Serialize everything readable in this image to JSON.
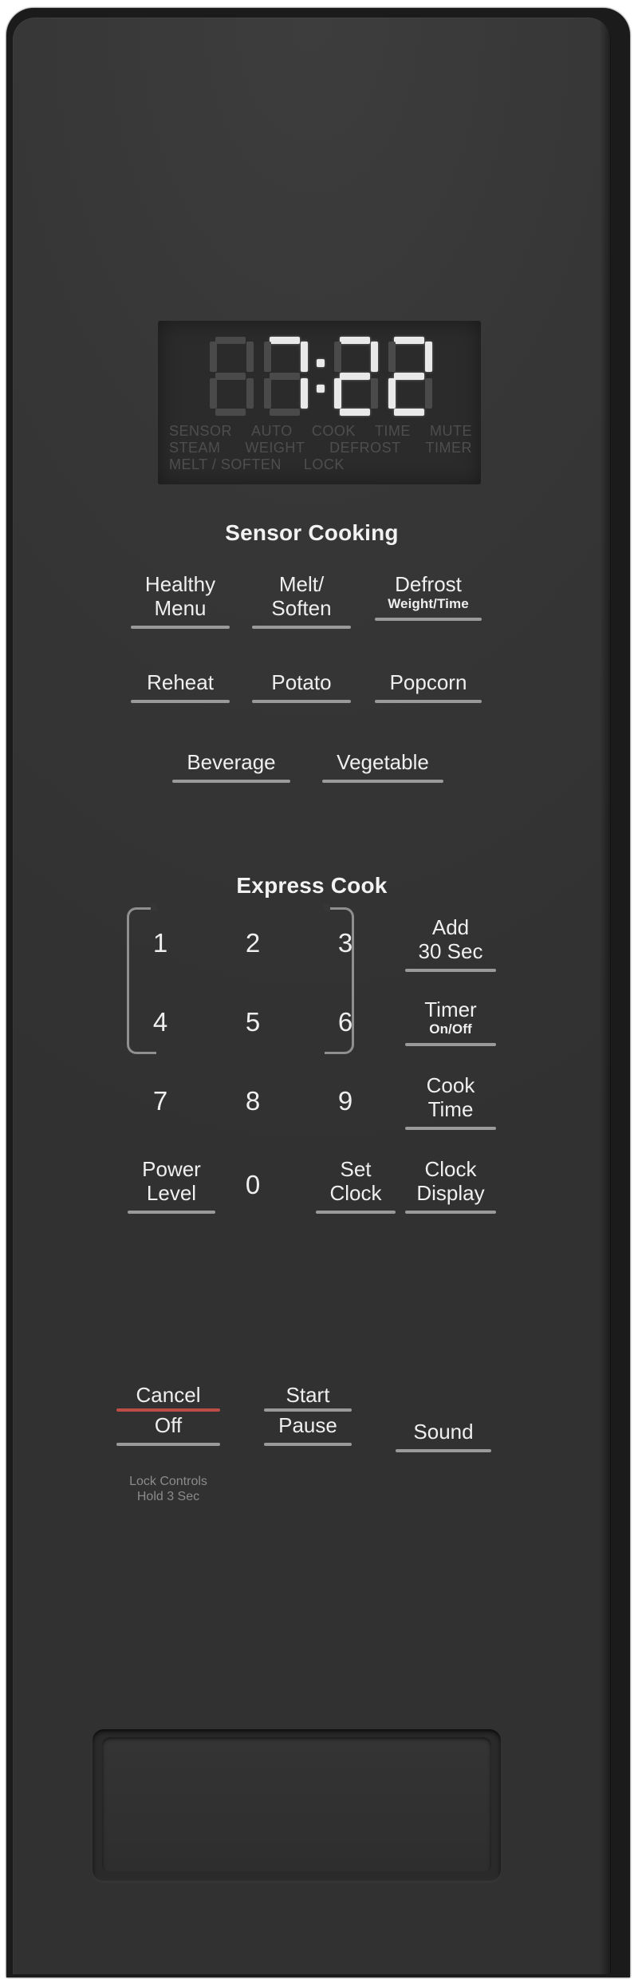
{
  "display": {
    "time": "7:22",
    "digits": [
      " ",
      "7",
      "2",
      "2"
    ],
    "colon_on": true,
    "indicator_rows": [
      [
        "SENSOR",
        "AUTO",
        "COOK",
        "TIME",
        "MUTE"
      ],
      [
        "STEAM",
        "WEIGHT",
        "DEFROST",
        "TIMER"
      ],
      [
        "MELT / SOFTEN",
        "LOCK"
      ]
    ]
  },
  "sensor_cooking": {
    "title": "Sensor Cooking",
    "row1": [
      {
        "line1": "Healthy",
        "line2": "Menu"
      },
      {
        "line1": "Melt/",
        "line2": "Soften"
      },
      {
        "line1": "Defrost",
        "line2": "Weight/Time"
      }
    ],
    "row2": [
      {
        "line1": "Reheat"
      },
      {
        "line1": "Potato"
      },
      {
        "line1": "Popcorn"
      }
    ],
    "row3": [
      {
        "line1": "Beverage"
      },
      {
        "line1": "Vegetable"
      }
    ]
  },
  "express_cook": {
    "title": "Express Cook",
    "keys": {
      "k1": "1",
      "k2": "2",
      "k3": "3",
      "k4": "4",
      "k5": "5",
      "k6": "6",
      "k7": "7",
      "k8": "8",
      "k9": "9",
      "k0": "0"
    },
    "power_level": {
      "line1": "Power",
      "line2": "Level"
    },
    "set_clock": {
      "line1": "Set",
      "line2": "Clock"
    },
    "add30": {
      "line1": "Add",
      "line2": "30 Sec"
    },
    "timer": {
      "line1": "Timer",
      "line2": "On/Off"
    },
    "cook_time": {
      "line1": "Cook",
      "line2": "Time"
    },
    "clock_display": {
      "line1": "Clock",
      "line2": "Display"
    }
  },
  "controls": {
    "cancel": {
      "line1": "Cancel",
      "line2": "Off"
    },
    "cancel_hint": {
      "line1": "Lock Controls",
      "line2": "Hold 3 Sec"
    },
    "start": {
      "line1": "Start",
      "line2": "Pause"
    },
    "sound": {
      "line1": "Sound"
    }
  },
  "colors": {
    "accent_red": "#bd4c47",
    "rule_gray": "#9a9a9a",
    "panel": "#363636",
    "display_bg": "#2b2b2b",
    "segment_on": "#e9e9e9",
    "segment_off": "#4a4a4a"
  }
}
